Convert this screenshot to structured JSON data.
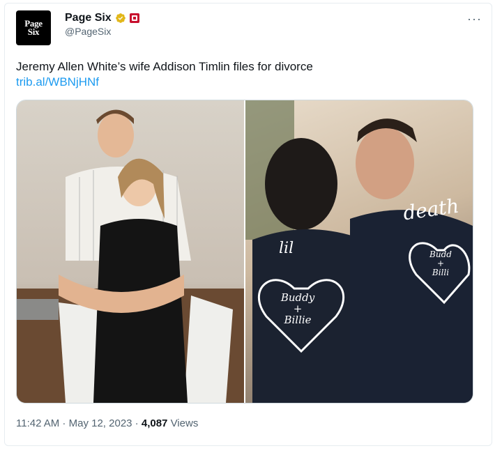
{
  "account": {
    "logo_top": "Page",
    "logo_bottom": "Six",
    "display_name": "Page Six",
    "handle": "@PageSix",
    "verified_icon": "verified-badge-icon",
    "affiliation_icon": "affiliation-badge-icon"
  },
  "menu": {
    "more_label": "···"
  },
  "tweet": {
    "text": "Jeremy Allen White’s wife Addison Timlin files for divorce",
    "link": "trib.al/WBNjHNf"
  },
  "media": {
    "right_jacket_text_1": "lil",
    "right_jacket_text_2": "death",
    "heart_text_1": "Buddy",
    "heart_text_2": "+",
    "heart_text_3": "Billie",
    "heart2_text_1": "Budd",
    "heart2_text_2": "+",
    "heart2_text_3": "Billi"
  },
  "footer": {
    "time": "11:42 AM",
    "sep1": " · ",
    "date": "May 12, 2023",
    "sep2": " · ",
    "views_count": "4,087",
    "views_label": " Views"
  },
  "colors": {
    "link": "#1d9bf0",
    "verified": "#e2b719",
    "secondary_text": "#536471"
  }
}
